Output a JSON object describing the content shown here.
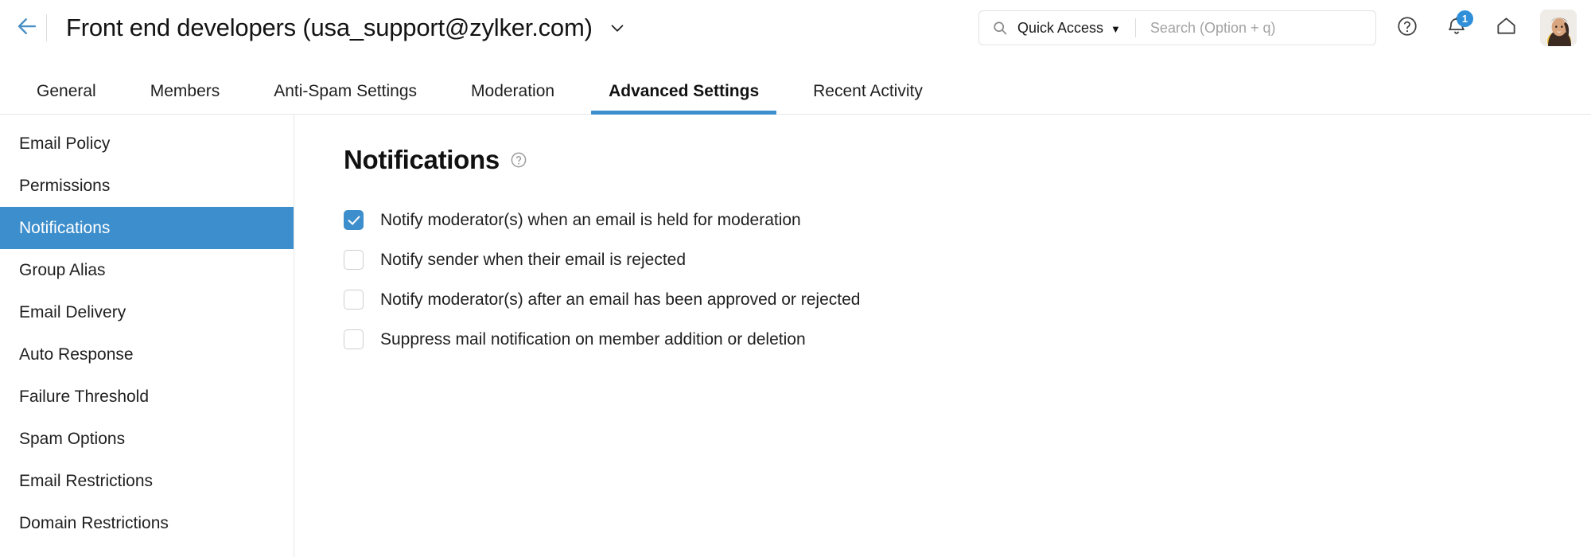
{
  "header": {
    "back_icon": "arrow-left-icon",
    "group_title": "Front end developers (usa_support@zylker.com)",
    "title_chevron_icon": "chevron-down-icon",
    "search": {
      "search_icon": "search-icon",
      "quick_access_label": "Quick Access",
      "quick_access_caret": "▼",
      "placeholder": "Search (Option + q)",
      "value": ""
    },
    "help_icon": "question-circle-icon",
    "notifications_icon": "bell-icon",
    "notifications_badge": "1",
    "home_icon": "home-icon",
    "avatar_icon": "user-avatar"
  },
  "tabs": [
    {
      "label": "General",
      "active": false
    },
    {
      "label": "Members",
      "active": false
    },
    {
      "label": "Anti-Spam Settings",
      "active": false
    },
    {
      "label": "Moderation",
      "active": false
    },
    {
      "label": "Advanced Settings",
      "active": true
    },
    {
      "label": "Recent Activity",
      "active": false
    }
  ],
  "sidebar": {
    "items": [
      {
        "label": "Email Policy",
        "active": false
      },
      {
        "label": "Permissions",
        "active": false
      },
      {
        "label": "Notifications",
        "active": true
      },
      {
        "label": "Group Alias",
        "active": false
      },
      {
        "label": "Email Delivery",
        "active": false
      },
      {
        "label": "Auto Response",
        "active": false
      },
      {
        "label": "Failure Threshold",
        "active": false
      },
      {
        "label": "Spam Options",
        "active": false
      },
      {
        "label": "Email Restrictions",
        "active": false
      },
      {
        "label": "Domain Restrictions",
        "active": false
      }
    ]
  },
  "main": {
    "heading": "Notifications",
    "heading_help_icon": "question-circle-icon",
    "options": [
      {
        "label": "Notify moderator(s) when an email is held for moderation",
        "checked": true
      },
      {
        "label": "Notify sender when their email is rejected",
        "checked": false
      },
      {
        "label": "Notify moderator(s) after an email has been approved or rejected",
        "checked": false
      },
      {
        "label": "Suppress mail notification on member addition or deletion",
        "checked": false
      }
    ]
  },
  "colors": {
    "accent_blue": "#3d8ecc",
    "badge_blue": "#2f8fd8",
    "back_arrow_blue": "#4a90c4",
    "border_grey": "#e6e6e6",
    "text_dark": "#1f1f1f",
    "placeholder_grey": "#a3a3a3"
  }
}
